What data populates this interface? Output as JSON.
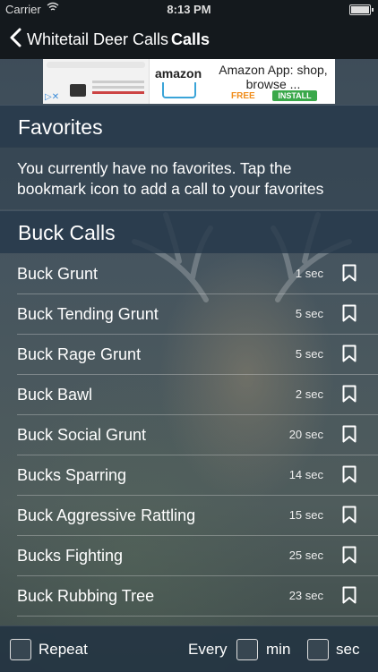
{
  "status_bar": {
    "carrier": "Carrier",
    "time": "8:13 PM"
  },
  "nav": {
    "back_label": "Whitetail Deer Calls",
    "title": "Calls"
  },
  "ad": {
    "search_text": "digital cameras",
    "brand": "amazon",
    "headline": "Amazon App: shop, browse ...",
    "free": "FREE",
    "install": "INSTALL"
  },
  "favorites": {
    "header": "Favorites",
    "message": "You currently have no favorites. Tap the bookmark icon to add a call to your favorites"
  },
  "buck_calls": {
    "header": "Buck Calls",
    "items": [
      {
        "name": "Buck Grunt",
        "duration": "1 sec"
      },
      {
        "name": "Buck Tending Grunt",
        "duration": "5 sec"
      },
      {
        "name": "Buck Rage Grunt",
        "duration": "5 sec"
      },
      {
        "name": "Buck Bawl",
        "duration": "2 sec"
      },
      {
        "name": "Buck Social Grunt",
        "duration": "20 sec"
      },
      {
        "name": "Bucks Sparring",
        "duration": "14 sec"
      },
      {
        "name": "Buck Aggressive Rattling",
        "duration": "15 sec"
      },
      {
        "name": "Bucks Fighting",
        "duration": "25 sec"
      },
      {
        "name": "Buck Rubbing Tree",
        "duration": "23 sec"
      }
    ]
  },
  "footer": {
    "repeat_label": "Repeat",
    "every_label": "Every",
    "min_label": "min",
    "sec_label": "sec"
  },
  "icons": {
    "back": "chevron-left-icon",
    "bookmark": "bookmark-icon",
    "wifi": "wifi-icon",
    "battery": "battery-icon"
  }
}
